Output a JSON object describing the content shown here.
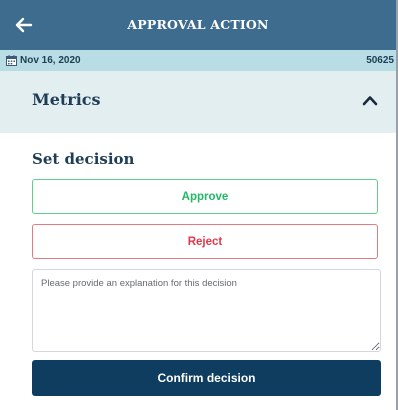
{
  "header": {
    "title": "APPROVAL ACTION",
    "back_icon": "arrow-left-icon"
  },
  "info_bar": {
    "date": "Nov 16, 2020",
    "id": "50625",
    "date_icon": "calendar-icon"
  },
  "metrics": {
    "title": "Metrics",
    "toggle_icon": "chevron-up-icon",
    "expanded": true
  },
  "decision": {
    "title": "Set decision",
    "approve_label": "Approve",
    "reject_label": "Reject",
    "explanation_placeholder": "Please provide an explanation for this decision",
    "explanation_value": "",
    "confirm_label": "Confirm decision"
  },
  "colors": {
    "header_bg": "#3d6c8f",
    "info_bar_bg": "#b8dde4",
    "metrics_bg": "#e3eef1",
    "approve": "#22b866",
    "reject": "#e0394a",
    "confirm_bg": "#0e3d5f",
    "heading_text": "#1f3d56"
  }
}
